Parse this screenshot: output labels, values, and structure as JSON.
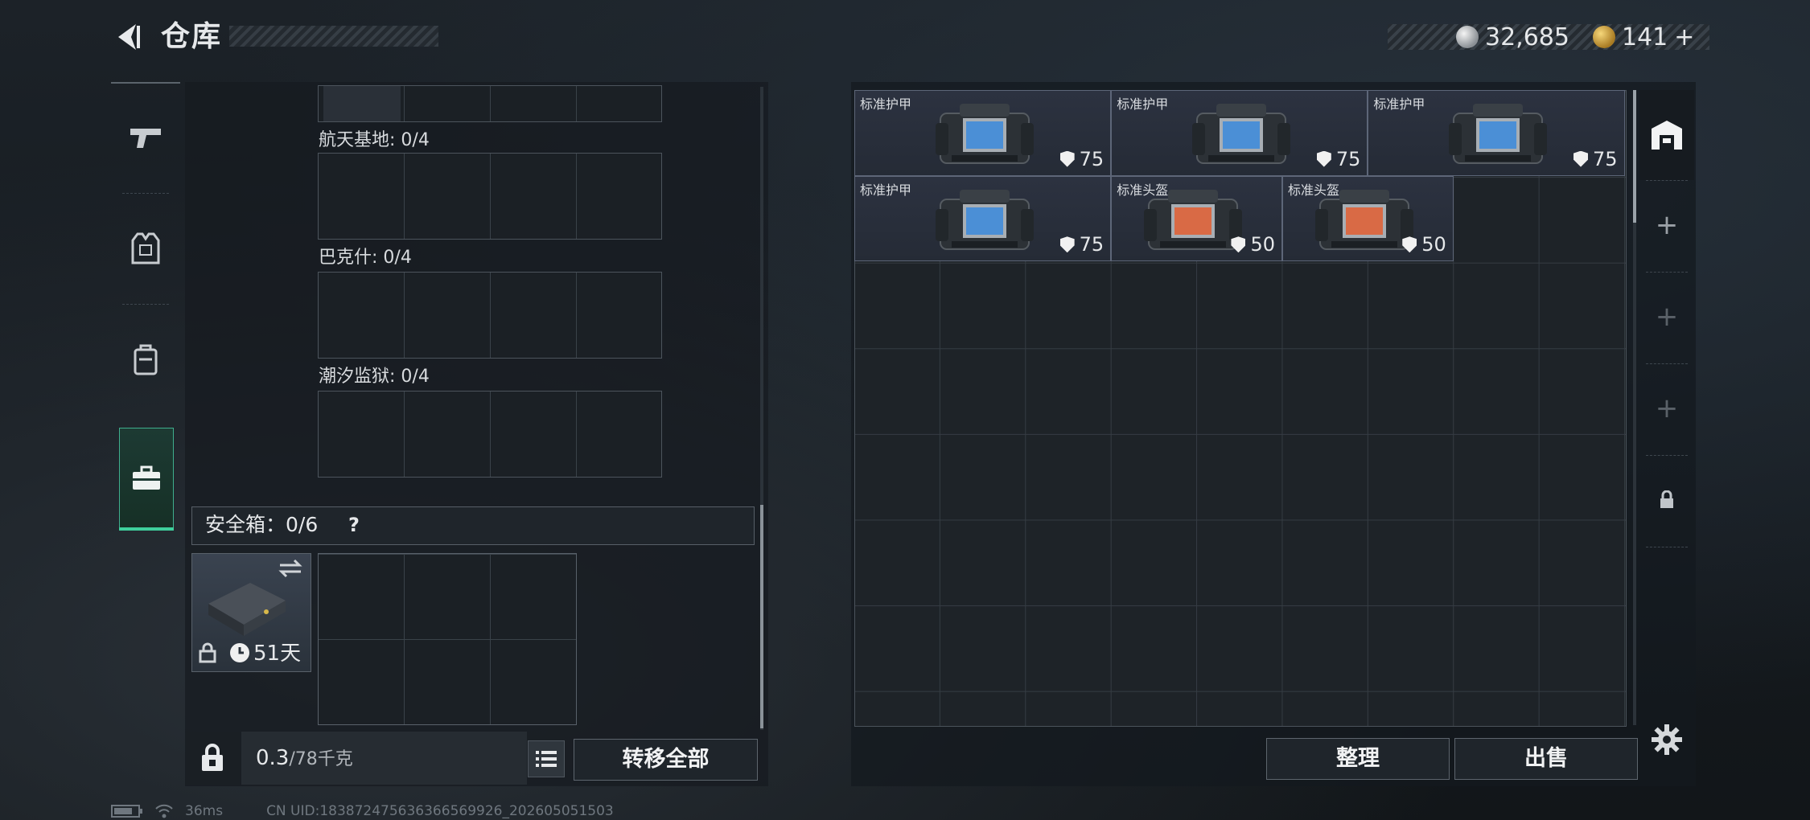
{
  "header": {
    "title": "仓库",
    "currency": [
      {
        "icon": "silver-coin-icon",
        "value": "32,685"
      },
      {
        "icon": "gold-coin-icon",
        "value": "141"
      }
    ],
    "add_symbol": "+"
  },
  "left_nav": {
    "items": [
      {
        "name": "weapons",
        "icon": "pistol-icon"
      },
      {
        "name": "armor",
        "icon": "vest-icon"
      },
      {
        "name": "backpack",
        "icon": "backpack-icon"
      },
      {
        "name": "case",
        "icon": "briefcase-icon",
        "selected": true
      }
    ]
  },
  "left_panel": {
    "sections": [
      {
        "label": "航天基地: 0/4"
      },
      {
        "label": "巴克什: 0/4"
      },
      {
        "label": "潮汐监狱: 0/4"
      }
    ],
    "safe_box": {
      "label": "安全箱：0/6",
      "help": "?",
      "days": "51天"
    },
    "footer": {
      "weight": "0.3",
      "weight_max": "/78千克",
      "transfer_all": "转移全部"
    }
  },
  "stash": {
    "items": [
      {
        "name": "标准护甲",
        "value": "75",
        "kind": "vest"
      },
      {
        "name": "标准护甲",
        "value": "75",
        "kind": "vest"
      },
      {
        "name": "标准护甲",
        "value": "75",
        "kind": "vest"
      },
      {
        "name": "标准护甲",
        "value": "75",
        "kind": "vest"
      },
      {
        "name": "标准头盔",
        "value": "50",
        "kind": "helmet"
      },
      {
        "name": "标准头盔",
        "value": "50",
        "kind": "helmet"
      }
    ],
    "buttons": {
      "sort": "整理",
      "sell": "出售"
    }
  },
  "status": {
    "ping": "36ms",
    "uid": "CN UID:183872475636366569926_202605051503"
  },
  "colors": {
    "accent": "#3fcf9c",
    "panel": "#1b2025"
  }
}
